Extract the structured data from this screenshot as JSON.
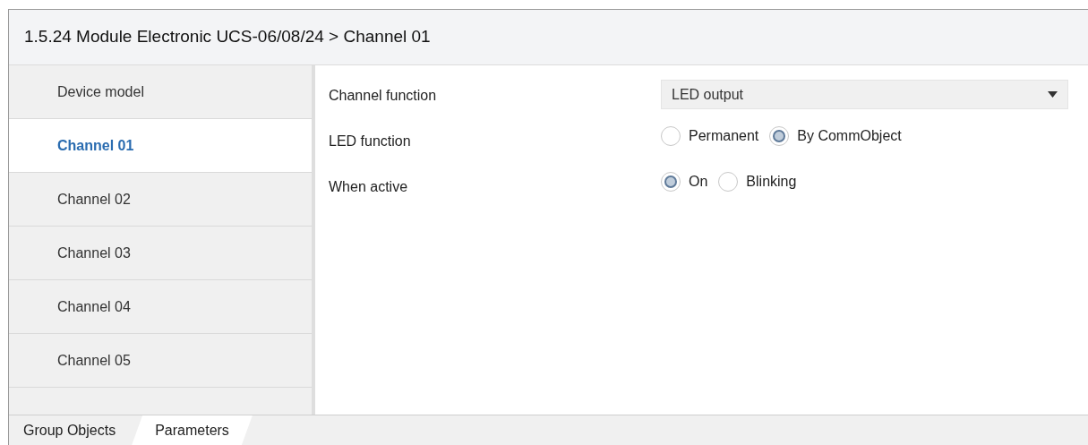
{
  "window": {
    "title": "1.5.24 Module Electronic UCS-06/08/24 > Channel 01"
  },
  "sidebar": {
    "items": [
      {
        "label": "Device model",
        "selected": false
      },
      {
        "label": "Channel 01",
        "selected": true
      },
      {
        "label": "Channel 02",
        "selected": false
      },
      {
        "label": "Channel 03",
        "selected": false
      },
      {
        "label": "Channel 04",
        "selected": false
      },
      {
        "label": "Channel 05",
        "selected": false
      }
    ]
  },
  "parameters": [
    {
      "kind": "dropdown",
      "label": "Channel function",
      "value": "LED output"
    },
    {
      "kind": "radio",
      "label": "LED function",
      "options": [
        {
          "label": "Permanent",
          "selected": false
        },
        {
          "label": "By CommObject",
          "selected": true
        }
      ]
    },
    {
      "kind": "radio",
      "label": "When active",
      "options": [
        {
          "label": "On",
          "selected": true
        },
        {
          "label": "Blinking",
          "selected": false
        }
      ]
    }
  ],
  "bottom_tabs": [
    {
      "label": "Group Objects",
      "selected": false
    },
    {
      "label": "Parameters",
      "selected": true
    }
  ]
}
